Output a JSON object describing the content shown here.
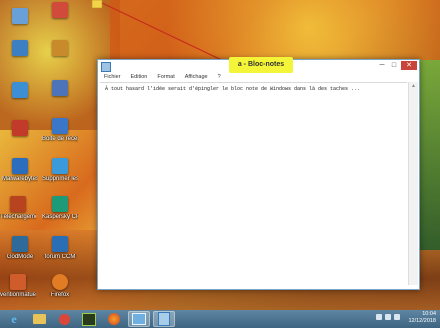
{
  "desktop": {
    "icons": [
      {
        "label": "",
        "color": "#6aa0d8"
      },
      {
        "label": "",
        "color": "#d14b3b"
      },
      {
        "label": "",
        "color": "#3c7fc2"
      },
      {
        "label": "",
        "color": "#c98a2c"
      },
      {
        "label": "",
        "color": "#3d8fd3"
      },
      {
        "label": "",
        "color": "#4d74b8"
      },
      {
        "label": "",
        "color": "#c23a2a"
      },
      {
        "label": "Boite de réception -...",
        "color": "#3a77c8"
      },
      {
        "label": "Malwarebytes Anti-Malware",
        "color": "#2d6dbd"
      },
      {
        "label": "Supprimer les cookies ou l...",
        "color": "#3b9ad9"
      },
      {
        "label": "Téléchargement",
        "color": "#b7441e"
      },
      {
        "label": "Kaspersky Cleaner",
        "color": "#1d9a77"
      },
      {
        "label": "GodMode",
        "color": "#2e6b9a"
      },
      {
        "label": "forum CCM",
        "color": "#2a6fb5"
      },
      {
        "label": "ventionmatuel ...",
        "color": "#d15c2b"
      },
      {
        "label": "Firefox",
        "color": "#e17b24"
      }
    ]
  },
  "annotation": {
    "text": "a - Bloc-notes",
    "color": "#f4f438"
  },
  "notepad": {
    "menu": [
      "Fichier",
      "Edition",
      "Format",
      "Affichage",
      "?"
    ],
    "content": "À tout hasard l'idée serait d'épingler le bloc note de Windows dans là des taches ...",
    "controls": {
      "minimize": "─",
      "maximize": "□",
      "close": "✕"
    }
  },
  "taskbar": {
    "time": "10:04",
    "date": "12/12/2018",
    "apps": [
      "ie-icon",
      "file-explorer-icon",
      "app-icon",
      "terminal-icon",
      "firefox-icon",
      "network-icon",
      "notepad-icon"
    ]
  }
}
